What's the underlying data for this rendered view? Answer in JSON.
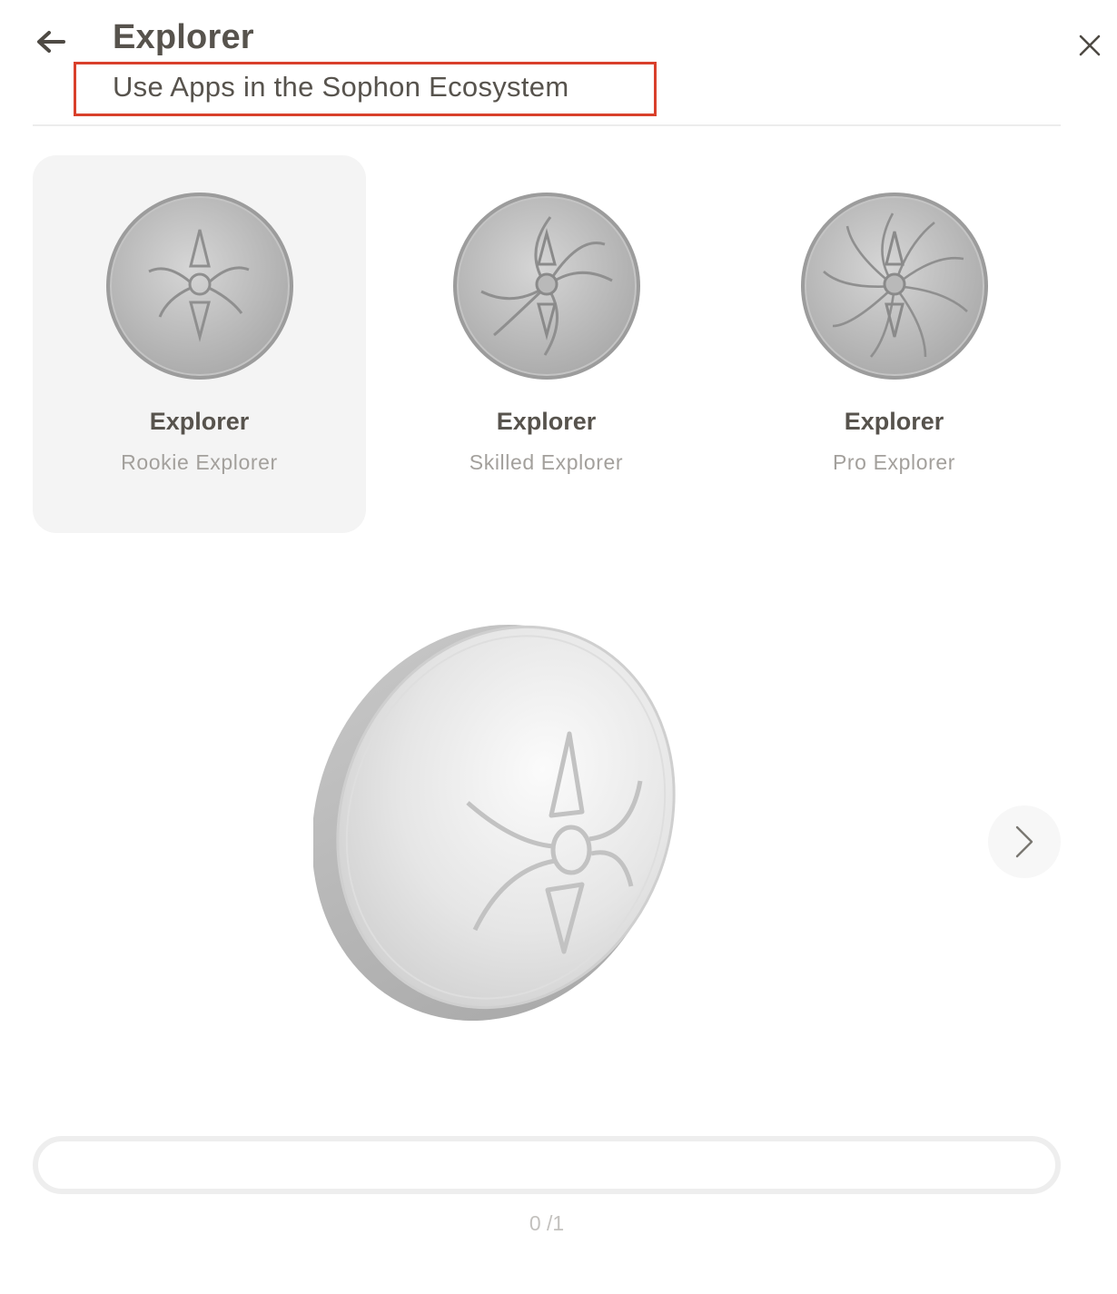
{
  "header": {
    "back_icon": "arrow-left-icon",
    "close_icon": "close-icon",
    "title": "Explorer",
    "subtitle": "Use Apps in the Sophon Ecosystem",
    "highlight_color": "#d9402b"
  },
  "badges": [
    {
      "title": "Explorer",
      "level": "Rookie Explorer",
      "selected": true,
      "icon": "rookie-medal-icon"
    },
    {
      "title": "Explorer",
      "level": "Skilled Explorer",
      "selected": false,
      "icon": "skilled-medal-icon"
    },
    {
      "title": "Explorer",
      "level": "Pro Explorer",
      "selected": false,
      "icon": "pro-medal-icon"
    }
  ],
  "preview": {
    "icon": "rookie-medal-3d-icon",
    "next_icon": "chevron-right-icon"
  },
  "progress": {
    "current": 0,
    "total": 1,
    "text": "0 /1",
    "fraction": 0
  }
}
